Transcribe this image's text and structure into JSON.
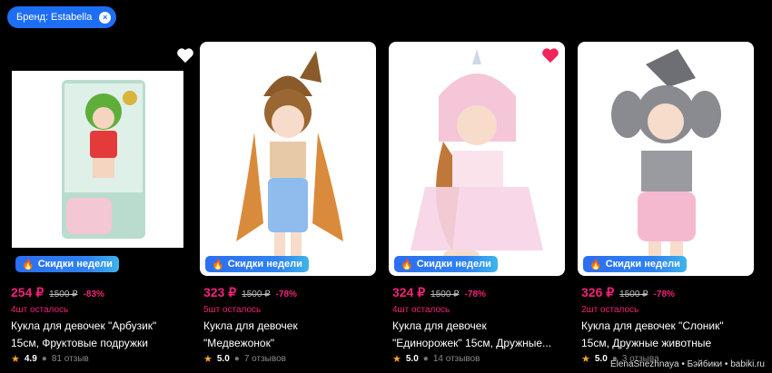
{
  "filter": {
    "label": "Бренд: Estabella"
  },
  "promo_label": "Скидки недели",
  "watermark": "ElenaSnezhnaya • Бэйбики • babiki.ru",
  "colors": {
    "accent": "#1e6ef5",
    "price": "#f2217a",
    "heart_active": "#f0245a",
    "star": "#f5a623"
  },
  "products": [
    {
      "price": "254 ₽",
      "old_price": "1500 ₽",
      "discount": "-83%",
      "stock": "4шт осталось",
      "title_line1": "Кукла для девочек \"Арбузик\"",
      "title_line2": "15см, Фруктовые подружки",
      "rating": "4.9",
      "reviews": "81 отзыв",
      "favorite": false
    },
    {
      "price": "323 ₽",
      "old_price": "1500 ₽",
      "discount": "-78%",
      "stock": "5шт осталось",
      "title_line1": "Кукла для девочек",
      "title_line2": "\"Медвежонок\"",
      "rating": "5.0",
      "reviews": "7 отзывов",
      "favorite": false
    },
    {
      "price": "324 ₽",
      "old_price": "1500 ₽",
      "discount": "-78%",
      "stock": "4шт осталось",
      "title_line1": "Кукла для девочек",
      "title_line2": "\"Единорожек\" 15см, Дружные...",
      "rating": "5.0",
      "reviews": "14 отзывов",
      "favorite": true
    },
    {
      "price": "326 ₽",
      "old_price": "1500 ₽",
      "discount": "-78%",
      "stock": "2шт осталось",
      "title_line1": "Кукла для девочек \"Слоник\"",
      "title_line2": "15см, Дружные животные",
      "rating": "5.0",
      "reviews": "3 отзыва",
      "favorite": false
    }
  ]
}
